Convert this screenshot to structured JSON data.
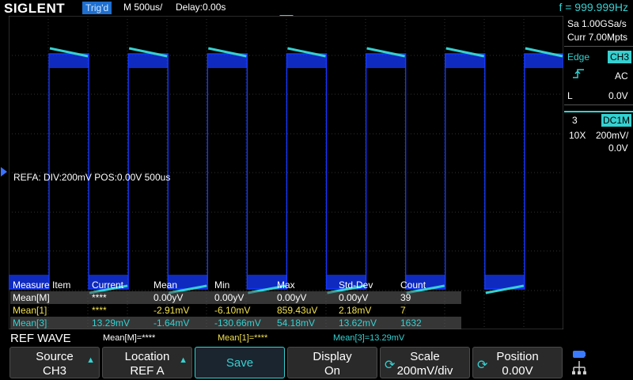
{
  "header": {
    "brand": "SIGLENT",
    "trig_status": "Trig'd",
    "timebase": "M 500us/",
    "delay": "Delay:0.00s",
    "frequency": "f = 999.999Hz"
  },
  "right_panel": {
    "sample_rate": "Sa 1.00GSa/s",
    "memory_depth": "Curr 7.00Mpts",
    "trigger_type": "Edge",
    "trigger_source": "CH3",
    "trigger_slope_icon": "rising-edge-icon",
    "coupling": "AC",
    "level_label": "L",
    "level_value": "0.0V",
    "channel_number": "3",
    "channel_coupling": "DC1M",
    "probe": "10X",
    "vdiv": "200mV/",
    "offset": "0.0V"
  },
  "overlay": {
    "ref_info": "REFA: DIV:200mV POS:0.00V  500us"
  },
  "measure_table": {
    "headers": [
      "Measure Item",
      "Current",
      "Mean",
      "Min",
      "Max",
      "Std-Dev",
      "Count"
    ],
    "rows": [
      {
        "color": "#ffffff",
        "cells": [
          "Mean[M]",
          "****",
          "0.00yV",
          "0.00yV",
          "0.00yV",
          "0.00yV",
          "39"
        ]
      },
      {
        "color": "#f2e14b",
        "cells": [
          "Mean[1]",
          "****",
          "-2.91mV",
          "-6.10mV",
          "859.43uV",
          "2.18mV",
          "7"
        ]
      },
      {
        "color": "#35d1d1",
        "cells": [
          "Mean[3]",
          "13.29mV",
          "-1.64mV",
          "-130.66mV",
          "54.18mV",
          "13.62mV",
          "1632"
        ]
      }
    ]
  },
  "status_bar": {
    "title": "REF WAVE",
    "items": [
      {
        "text": "Mean[M]=****",
        "color": "#ffffff"
      },
      {
        "text": "Mean[1]=****",
        "color": "#f2e14b"
      },
      {
        "text": "Mean[3]=13.29mV",
        "color": "#35d1d1"
      }
    ]
  },
  "softkeys": [
    {
      "label": "Source",
      "value": "CH3"
    },
    {
      "label": "Location",
      "value": "REF A"
    },
    {
      "label": "Save",
      "value": ""
    },
    {
      "label": "Display",
      "value": "On"
    },
    {
      "label": "Scale",
      "value": "200mV/div"
    },
    {
      "label": "Position",
      "value": "0.00V"
    }
  ],
  "colors": {
    "ch3_trace": "#35d1d1",
    "ref_trace": "#1438ff",
    "trig_badge": "#1e6fd0",
    "channel1_text": "#f2e14b"
  }
}
